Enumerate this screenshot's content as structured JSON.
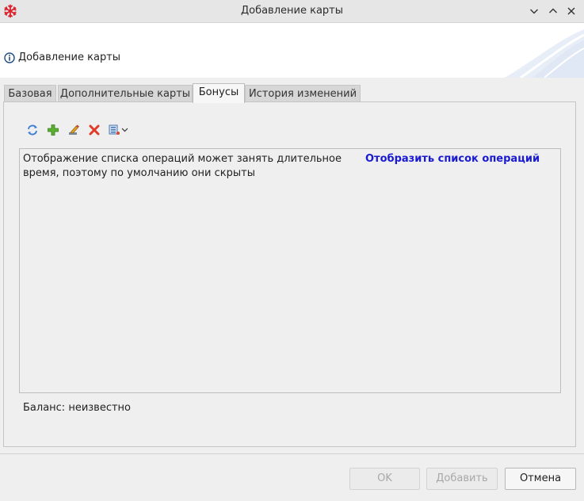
{
  "window": {
    "title": "Добавление карты"
  },
  "header": {
    "text": "Добавление карты",
    "icon": "info-icon"
  },
  "tabs": [
    {
      "label": "Базовая",
      "active": false
    },
    {
      "label": "Дополнительные карты",
      "active": false
    },
    {
      "label": "Бонусы",
      "active": true
    },
    {
      "label": "История изменений",
      "active": false
    }
  ],
  "toolbar": {
    "icons": [
      "refresh-icon",
      "add-icon",
      "edit-icon",
      "delete-icon",
      "view-options-icon"
    ]
  },
  "operations": {
    "message": "Отображение списка операций может занять длительное время, поэтому по умолчанию они скрыты",
    "show_link": "Отобразить список операций"
  },
  "balance": {
    "text": "Баланс: неизвестно"
  },
  "buttons": {
    "ok": "OK",
    "add": "Добавить",
    "cancel": "Отмена"
  },
  "colors": {
    "link": "#1a1ad0",
    "app_icon": "#d9232e"
  }
}
